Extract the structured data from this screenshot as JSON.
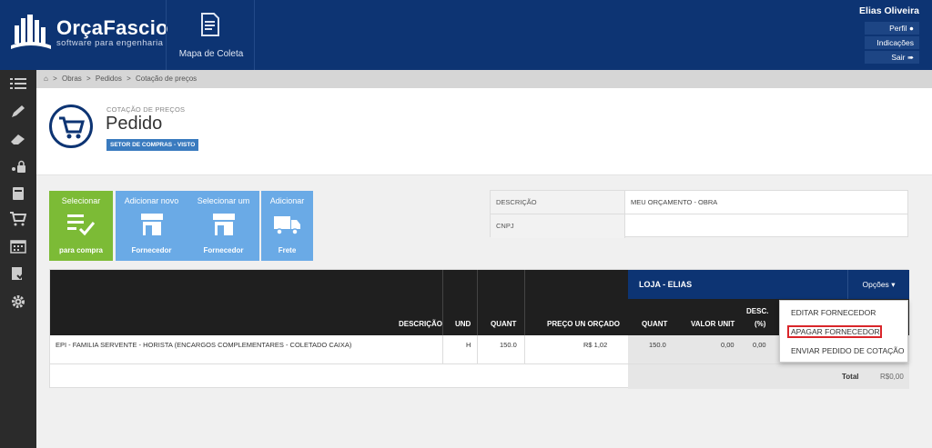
{
  "header": {
    "logo_title": "OrçaFascio",
    "logo_subtitle": "software para engenharia",
    "mapa_label": "Mapa de Coleta",
    "user_name": "Elias Oliveira",
    "user_menu": [
      "Perfil",
      "Indicações",
      "Sair"
    ]
  },
  "sidebar": {
    "icons": [
      "list-icon",
      "pencil-icon",
      "eraser-icon",
      "lock-people-icon",
      "book-icon",
      "cart-icon",
      "calendar-icon",
      "checklist-icon",
      "gear-icon"
    ]
  },
  "breadcrumb": [
    "Obras",
    "Pedidos",
    "Cotação de preços"
  ],
  "page": {
    "subtitle": "COTAÇÃO DE PREÇOS",
    "title": "Pedido",
    "badge": "SETOR DE COMPRAS - VISTO"
  },
  "tiles": [
    {
      "top": "Selecionar",
      "bottom": "para compra",
      "icon": "list-check-icon"
    },
    {
      "top": "Adicionar novo",
      "bottom": "Fornecedor",
      "icon": "store-icon"
    },
    {
      "top": "Selecionar um",
      "bottom": "Fornecedor",
      "icon": "store-icon"
    },
    {
      "top": "Adicionar",
      "bottom": "Frete",
      "icon": "truck-icon"
    }
  ],
  "info": {
    "descricao_label": "DESCRIÇÃO",
    "descricao_value": "MEU ORÇAMENTO - OBRA",
    "cnpj_label": "CNPJ",
    "cnpj_value": ""
  },
  "table": {
    "headers": {
      "descricao": "DESCRIÇÃO",
      "und": "UND",
      "quant": "QUANT",
      "preco": "PREÇO UN ORÇADO",
      "loja_quant": "QUANT",
      "valor_unit": "VALOR UNIT",
      "desc": "DESC.",
      "desc_pct": "(%)"
    },
    "loja_title": "LOJA - ELIAS",
    "opcoes_label": "Opções",
    "row": {
      "descricao": "EPI - FAMILIA SERVENTE - HORISTA (ENCARGOS COMPLEMENTARES - COLETADO CAIXA)",
      "und": "H",
      "quant": "150.0",
      "preco": "R$ 1,02",
      "loja_quant": "150.0",
      "valor_unit": "0,00",
      "desc": "0,00"
    },
    "total_label": "Total",
    "total_value": "R$0,00"
  },
  "dropdown": {
    "items": [
      "EDITAR FORNECEDOR",
      "APAGAR FORNECEDOR",
      "ENVIAR PEDIDO DE COTAÇÃO"
    ]
  },
  "colors": {
    "brand": "#0d3473",
    "green_tile": "#7cbb36",
    "blue_tile": "#6aaae6",
    "highlight": "#d9252a"
  }
}
